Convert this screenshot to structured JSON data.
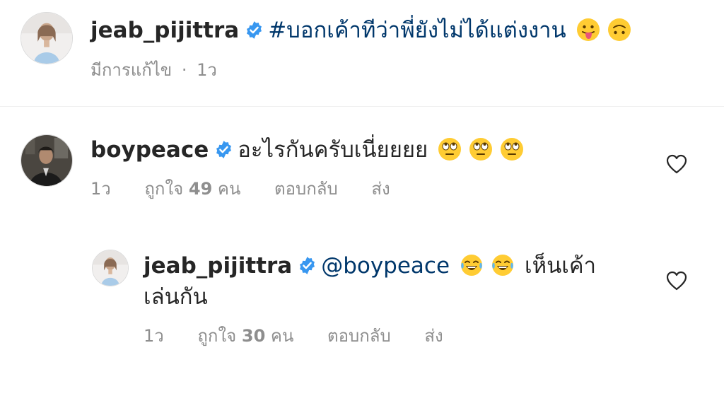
{
  "caption": {
    "username": "jeab_pijittra",
    "text": "#บอกเค้าทีว่าพี่ยังไม่ได้แต่งงาน",
    "emojis": [
      "tongue-face",
      "upside-down-face"
    ],
    "edited_label": "มีการแก้ไข",
    "dot": "·",
    "time": "1ว"
  },
  "comments": [
    {
      "username": "boypeace",
      "text": "อะไรกันครับเนี่ยยยย",
      "emojis": [
        "eye-roll-face",
        "eye-roll-face",
        "eye-roll-face"
      ],
      "time": "1ว",
      "likes_prefix": "ถูกใจ",
      "likes_count": "49",
      "likes_suffix": "คน",
      "reply_label": "ตอบกลับ",
      "send_label": "ส่ง"
    }
  ],
  "reply": {
    "username": "jeab_pijittra",
    "mention": "@boypeace",
    "emojis": [
      "tears-of-joy-face",
      "tears-of-joy-face"
    ],
    "text_line1": "เห็นเค้า",
    "text_line2": "เล่นกัน",
    "time": "1ว",
    "likes_prefix": "ถูกใจ",
    "likes_count": "30",
    "likes_suffix": "คน",
    "reply_label": "ตอบกลับ",
    "send_label": "ส่ง"
  },
  "colors": {
    "text": "#262626",
    "secondary": "#8e8e8e",
    "link": "#00376b",
    "verified": "#3897f0"
  }
}
